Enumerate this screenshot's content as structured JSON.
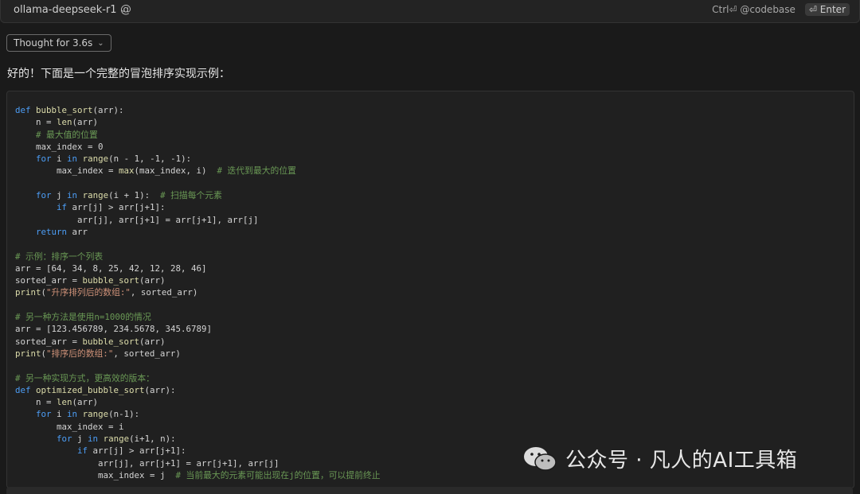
{
  "header": {
    "model": "ollama-deepseek-r1",
    "ctrl_hint": "Ctrl⏎ @codebase",
    "enter_label": "⏎ Enter"
  },
  "thought": {
    "label": "Thought for 3.6s"
  },
  "message": {
    "intro": "好的！下面是一个完整的冒泡排序实现示例："
  },
  "code": {
    "lines": [
      "def bubble_sort(arr):",
      "    n = len(arr)",
      "    # 最大值的位置",
      "    max_index = 0",
      "    for i in range(n - 1, -1, -1):",
      "        max_index = max(max_index, i)  # 迭代到最大的位置",
      "",
      "    for j in range(i + 1):  # 扫描每个元素",
      "        if arr[j] > arr[j+1]:",
      "            arr[j], arr[j+1] = arr[j+1], arr[j]",
      "    return arr",
      "",
      "# 示例：排序一个列表",
      "arr = [64, 34, 8, 25, 42, 12, 28, 46]",
      "sorted_arr = bubble_sort(arr)",
      "print(\"升序排列后的数组:\", sorted_arr)",
      "",
      "# 另一种方法是使用n=1000的情况",
      "arr = [123.456789, 234.5678, 345.6789]",
      "sorted_arr = bubble_sort(arr)",
      "print(\"排序后的数组:\", sorted_arr)",
      "",
      "# 另一种实现方式，更高效的版本：",
      "def optimized_bubble_sort(arr):",
      "    n = len(arr)",
      "    for i in range(n-1):",
      "        max_index = i",
      "        for j in range(i+1, n):",
      "            if arr[j] > arr[j+1]:",
      "                arr[j], arr[j+1] = arr[j+1], arr[j]",
      "                max_index = j  # 当前最大的元素可能出现在j的位置，可以提前终止"
    ]
  },
  "watermark": {
    "text": "公众号 · 凡人的AI工具箱"
  },
  "colors": {
    "keyword": "#4c9df5",
    "function": "#dcdcaa",
    "comment": "#6a9955",
    "string": "#ce9178"
  }
}
